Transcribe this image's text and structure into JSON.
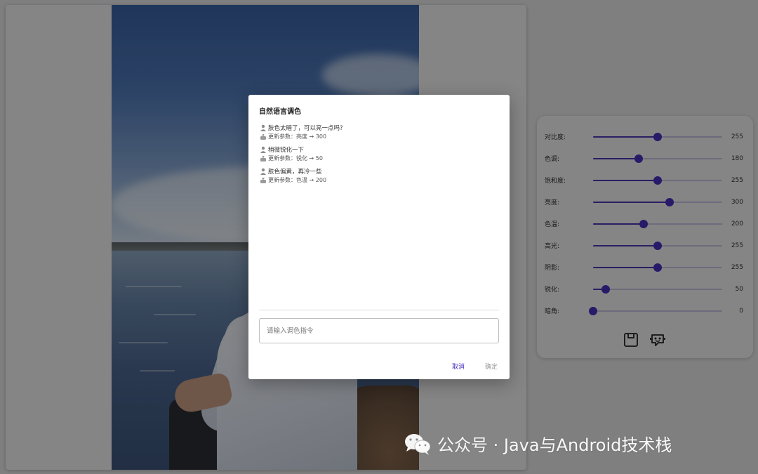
{
  "dialog": {
    "title": "自然语言调色",
    "chat": [
      {
        "user": "肤色太暗了，可以亮一点吗?",
        "reply": "更新参数：亮度 → 300"
      },
      {
        "user": "稍微锐化一下",
        "reply": "更新参数：锐化 → 50"
      },
      {
        "user": "肤色偏黄，再冷一些",
        "reply": "更新参数：色温 → 200"
      }
    ],
    "input": {
      "value": "",
      "placeholder": "请输入调色指令"
    },
    "cancel_label": "取消",
    "ok_label": "确定"
  },
  "controls": {
    "max": 510,
    "sliders": [
      {
        "label": "对比度:",
        "value": 255
      },
      {
        "label": "色调:",
        "value": 180
      },
      {
        "label": "饱和度:",
        "value": 255
      },
      {
        "label": "亮度:",
        "value": 300
      },
      {
        "label": "色温:",
        "value": 200
      },
      {
        "label": "高光:",
        "value": 255
      },
      {
        "label": "阴影:",
        "value": 255
      },
      {
        "label": "锐化:",
        "value": 50
      },
      {
        "label": "暗角:",
        "value": 0
      }
    ],
    "actions": [
      {
        "name": "save-icon"
      },
      {
        "name": "ai-assistant-icon"
      }
    ]
  },
  "watermark": {
    "text": "公众号 · Java与Android技术栈"
  },
  "colors": {
    "accent": "#4a30c0",
    "rail": "#c9c2e4",
    "overlay": "rgba(0,0,0,0.45)"
  }
}
